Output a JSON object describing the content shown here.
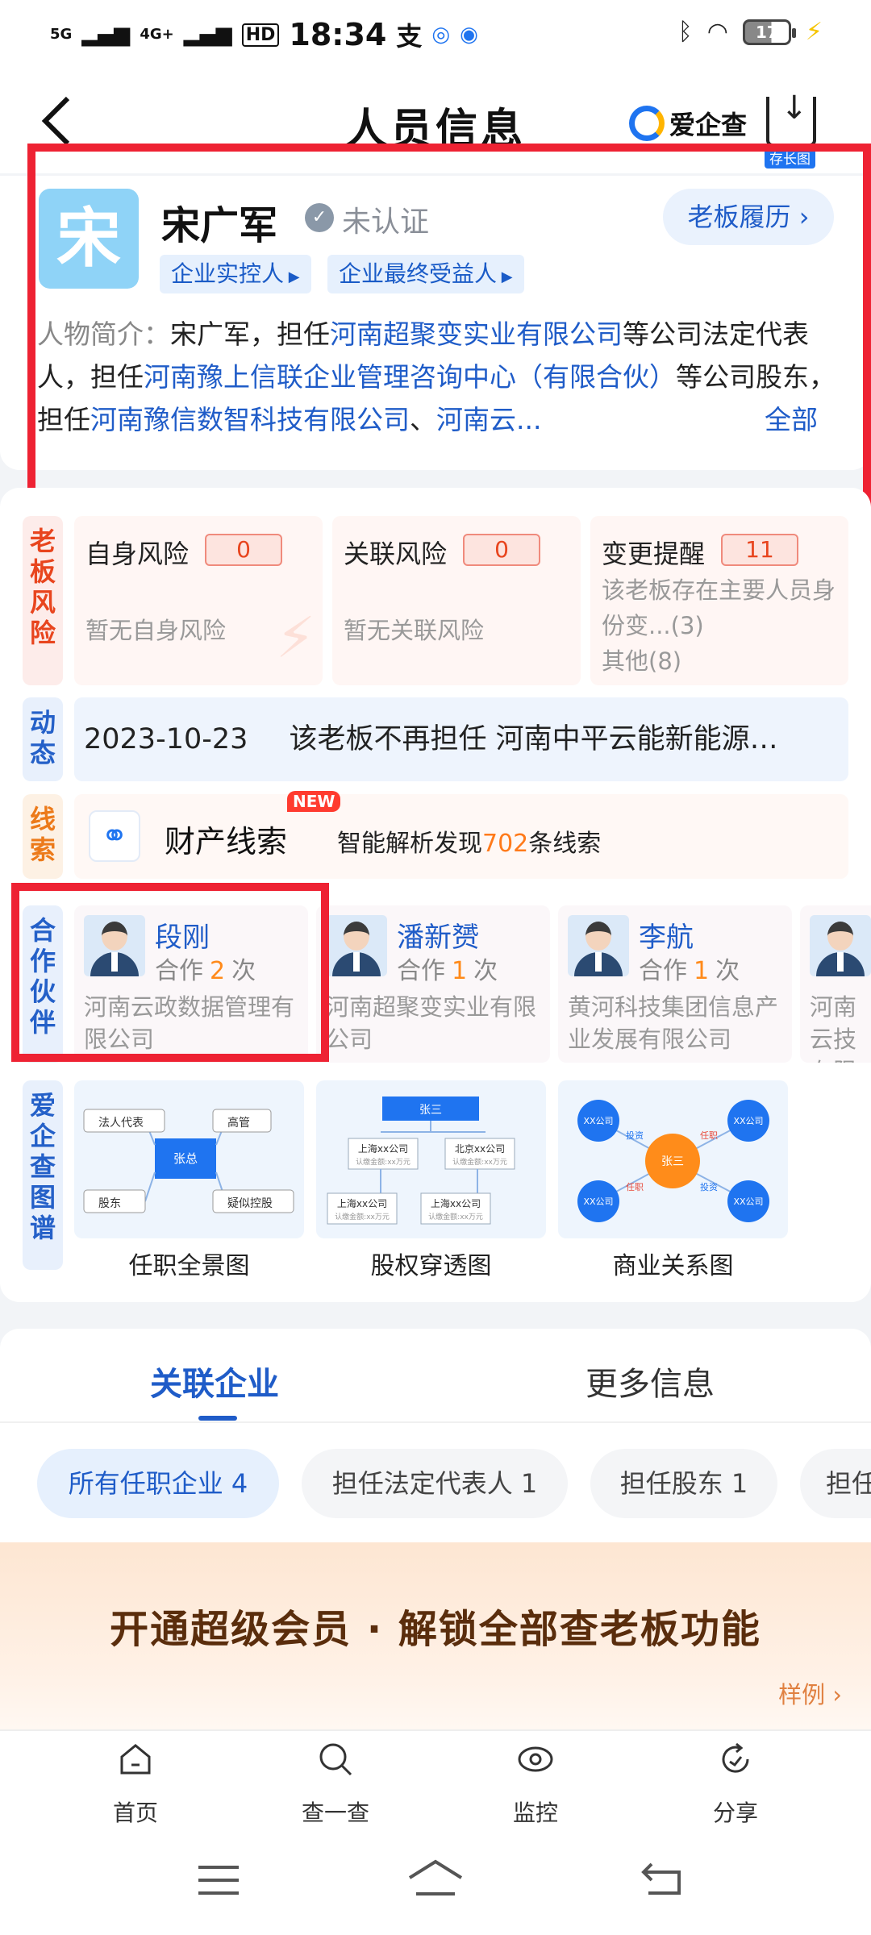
{
  "status_bar": {
    "network_left": "5G",
    "network_right": "4G+",
    "hd": "HD",
    "time": "18:34",
    "battery": "17"
  },
  "header": {
    "title": "人员信息",
    "brand": "爱企查",
    "download_label": "存长图"
  },
  "profile": {
    "avatar_char": "宋",
    "name": "宋广军",
    "verify_status": "未认证",
    "boss_resume": "老板履历",
    "tags": [
      "企业实控人",
      "企业最终受益人"
    ],
    "bio_label": "人物简介：",
    "bio_p1": "宋广军，担任",
    "bio_l1": "河南超聚变实业有限公司",
    "bio_p2": "等公司法定代表人，担任",
    "bio_l2": "河南豫上信联企业管理咨询中心（有限合伙）",
    "bio_p3": "等公司股东，担任",
    "bio_l3": "河南豫信数智科技有限公司",
    "bio_p4": "、",
    "bio_l4": "河南云...",
    "bio_more": "全部"
  },
  "risk": {
    "label": "老板风险",
    "self": {
      "title": "自身风险",
      "count": "0",
      "desc": "暂无自身风险"
    },
    "related": {
      "title": "关联风险",
      "count": "0",
      "desc": "暂无关联风险"
    },
    "change": {
      "title": "变更提醒",
      "count": "11",
      "desc1": "该老板存在主要人员身份变...(3)",
      "desc2": "其他(8)"
    }
  },
  "dynamic": {
    "label": "动态",
    "date": "2023-10-23",
    "text": "该老板不再担任  河南中平云能新能源…"
  },
  "clue": {
    "label": "线索",
    "title": "财产线索",
    "badge": "NEW",
    "text_pre": "智能解析发现",
    "count": "702",
    "text_post": "条线索"
  },
  "partners": {
    "label": "合作伙伴",
    "times_pre": "合作",
    "times_post": "次",
    "items": [
      {
        "name": "段刚",
        "count": "2",
        "company": "河南云政数据管理有限公司"
      },
      {
        "name": "潘新赟",
        "count": "1",
        "company": "河南超聚变实业有限公司"
      },
      {
        "name": "李航",
        "count": "1",
        "company": "黄河科技集团信息产业发展有限公司"
      },
      {
        "name": "",
        "count": "",
        "company": "河南云技有限"
      }
    ]
  },
  "graphs": {
    "label": "爱企查图谱",
    "items": [
      {
        "title": "任职全景图",
        "center": "张总",
        "nodes": [
          "法人代表",
          "高管",
          "股东",
          "疑似控股"
        ]
      },
      {
        "title": "股权穿透图",
        "top": "张三",
        "mid": [
          "上海xx公司",
          "北京xx公司"
        ],
        "bottom": [
          "上海xx公司",
          "上海xx公司"
        ],
        "sub": "认缴金额:xx万元"
      },
      {
        "title": "商业关系图",
        "center": "张三",
        "node": "XX公司",
        "edges": [
          "投资",
          "任职"
        ]
      }
    ]
  },
  "tabs": {
    "active": "关联企业",
    "inactive": "更多信息"
  },
  "filters": [
    {
      "label": "所有任职企业",
      "count": "4"
    },
    {
      "label": "担任法定代表人",
      "count": "1"
    },
    {
      "label": "担任股东",
      "count": "1"
    },
    {
      "label": "担任",
      "count": ""
    }
  ],
  "vip": {
    "title": "开通超级会员 · 解锁全部查老板功能",
    "sample": "样例"
  },
  "bottom_nav": [
    {
      "label": "首页",
      "icon": "home-icon"
    },
    {
      "label": "查一查",
      "icon": "search-icon"
    },
    {
      "label": "监控",
      "icon": "eye-icon"
    },
    {
      "label": "分享",
      "icon": "share-icon"
    }
  ],
  "colors": {
    "primary_blue": "#1f5cc8",
    "risk_red": "#e8451e",
    "highlight_orange": "#ff7a1a",
    "annotation_red": "#ee2233"
  }
}
